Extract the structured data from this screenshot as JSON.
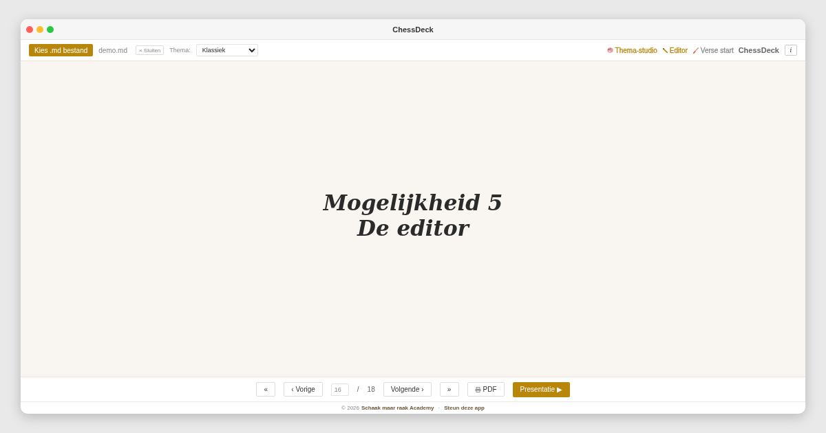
{
  "window": {
    "title": "ChessDeck"
  },
  "toolbar": {
    "open_button": "Kies .md bestand",
    "file_name": "demo.md",
    "close_button": "× Sluiten",
    "theme_label": "Thema:",
    "theme_select": {
      "value": "Klassiek"
    },
    "links": [
      {
        "label": "Thema-studio",
        "kind": "palette",
        "color": "#b8860b"
      },
      {
        "label": "Editor",
        "kind": "pencil",
        "color": "#b8860b"
      },
      {
        "label": "Verse start",
        "kind": "brush",
        "color": "#8a8a8a"
      }
    ],
    "brand": "ChessDeck",
    "info_button": "i"
  },
  "slide": {
    "title_lines": [
      "Mogelijkheid 5",
      "De editor"
    ]
  },
  "navigation": {
    "first_button": "«",
    "previous_button": "‹ Vorige",
    "page_input": {
      "value": "16"
    },
    "separator": "/",
    "total_pages": "18",
    "next_button": "Volgende ›",
    "last_button": "»",
    "pdf_button": "PDF",
    "present_button": "Presentatie ▶"
  },
  "footer": {
    "copyright": "© 2026",
    "organization_link": "Schaak maar raak Academy",
    "separator": "·",
    "support_link": "Steun deze app"
  }
}
